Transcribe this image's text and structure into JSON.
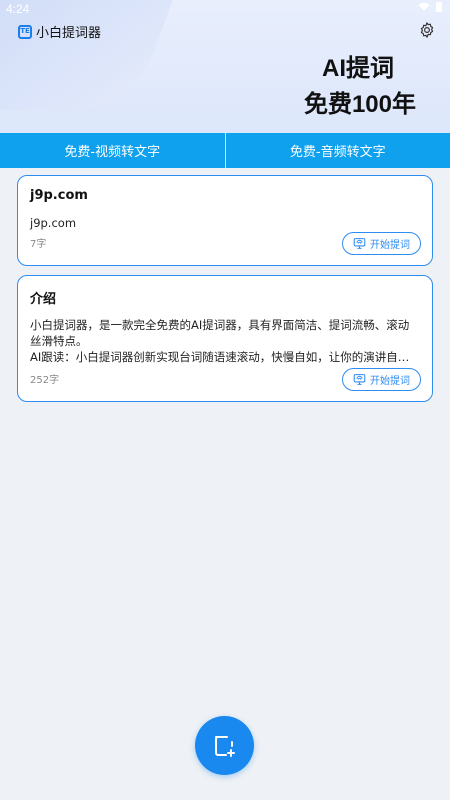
{
  "status": {
    "time": "4:24"
  },
  "app": {
    "title": "小白提词器",
    "logo_text": "TE"
  },
  "hero": {
    "line1": "AI提词",
    "line2": "免费100年"
  },
  "tabs": [
    {
      "label": "免费-视频转文字"
    },
    {
      "label": "免费-音频转文字"
    }
  ],
  "cards": [
    {
      "title": "j9p.com",
      "body_lines": [
        "j9p.com"
      ],
      "count": "7字",
      "button_label": "开始提词"
    },
    {
      "title": "介绍",
      "body_lines": [
        "小白提词器，是一款完全免费的AI提词器，具有界面简洁、提词流畅、滚动",
        "丝滑特点。",
        "AI跟读：小白提词器创新实现台词随语速滚动，快慢自如，让你的演讲自然..."
      ],
      "count": "252字",
      "button_label": "开始提词"
    }
  ],
  "colors": {
    "accent": "#2f8cf0",
    "tab_bar": "#0fa0ee",
    "fab": "#1989f0",
    "background": "#eef1f5"
  },
  "icons": {
    "settings": "gear-icon",
    "start_prompt": "prompt-screen-icon",
    "fab": "add-document-icon"
  }
}
